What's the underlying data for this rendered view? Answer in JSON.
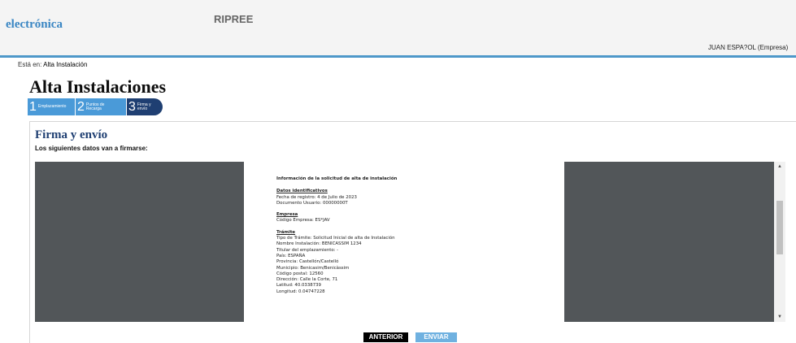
{
  "header": {
    "brand": "electrónica",
    "app_name": "RIPREE",
    "user": "JUAN ESPA?OL (Empresa)"
  },
  "breadcrumb": {
    "label": "Está en:",
    "current": "Alta Instalación"
  },
  "page_title": "Alta Instalaciones",
  "steps": [
    {
      "number": "1",
      "label": "Emplazamiento"
    },
    {
      "number": "2",
      "label": "Puntos de Recarga"
    },
    {
      "number": "3",
      "label": "Firma y envío"
    }
  ],
  "section": {
    "title": "Firma y envío",
    "subtitle": "Los siguientes datos van a firmarse:"
  },
  "document": {
    "heading": "Información de la solicitud de alta de instalación",
    "blocks": [
      {
        "title": "Datos identificativos",
        "lines": [
          "Fecha de registro: 4 de Julio de 2023",
          "Documento Usuario: 00000000T"
        ]
      },
      {
        "title": "Empresa",
        "lines": [
          "Código Empresa: ES*JAV"
        ]
      },
      {
        "title": "Trámite",
        "lines": [
          "Tipo de Trámite: Solicitud Inicial de alta de Instalación",
          "Nombre Instalación: BENICASSIM  1234",
          "Titular del emplazamiento: -",
          "País: ESPAÑA",
          "Provincia: Castellón/Castelló",
          "Municipio: Benicasim/Benicàssim",
          "Código postal: 12560",
          "Dirección: Calle la Corte, 71",
          "Latitud: 40.0338739",
          "Longitud: 0.04747228"
        ]
      }
    ]
  },
  "icons": {
    "scroll_up": "arrow-up-icon",
    "scroll_down": "arrow-down-icon"
  },
  "buttons": {
    "back": "ANTERIOR",
    "send": "ENVIAR"
  },
  "colors": {
    "accent": "#4a9ad8",
    "active_step": "#1f3f72",
    "header_line": "#4e98c9",
    "viewer_bg": "#525659"
  }
}
